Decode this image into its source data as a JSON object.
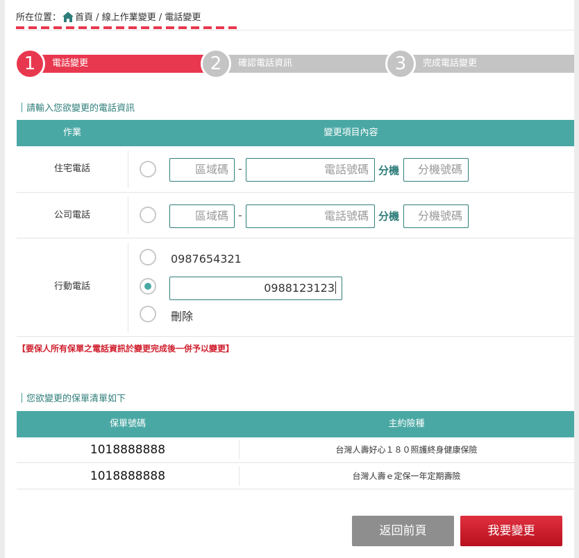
{
  "breadcrumb": {
    "prefix": "所在位置：",
    "home": "首頁",
    "sep1": " / ",
    "level1": "線上作業變更",
    "sep2": " / ",
    "current": "電話變更"
  },
  "steps": [
    {
      "number": "1",
      "label": "電話變更",
      "active": true
    },
    {
      "number": "2",
      "label": "確認電話資訊",
      "active": false
    },
    {
      "number": "3",
      "label": "完成電話變更",
      "active": false
    }
  ],
  "phone_section": {
    "heading": "請輸入您欲變更的電話資訊",
    "col_task": "作業",
    "col_content": "變更項目內容",
    "dash": "-",
    "ext_label": "分機",
    "home_phone": {
      "label": "住宅電話",
      "area_placeholder": "區域碼",
      "number_placeholder": "電話號碼",
      "ext_placeholder": "分機號碼"
    },
    "office_phone": {
      "label": "公司電話",
      "area_placeholder": "區域碼",
      "number_placeholder": "電話號碼",
      "ext_placeholder": "分機號碼"
    },
    "mobile": {
      "label": "行動電話",
      "current_number": "0987654321",
      "new_number": "0988123123",
      "delete_label": "刪除",
      "selected_option": "new_number"
    }
  },
  "notice": "【要保人所有保單之電話資訊於變更完成後一併予以變更】",
  "policy_section": {
    "heading": "您欲變更的保單清單如下",
    "col_number": "保單號碼",
    "col_product": "主約險種",
    "rows": [
      {
        "number": "1018888888",
        "product": "台灣人壽好心１８０照護終身健康保險"
      },
      {
        "number": "1018888888",
        "product": "台灣人壽ｅ定保一年定期壽險"
      }
    ]
  },
  "buttons": {
    "back": "返回前頁",
    "submit": "我要變更"
  },
  "colors": {
    "accent_red": "#e8384f",
    "teal": "#4aa8a4",
    "step_inactive": "#c4c4c4",
    "notice_red": "#d0212f"
  }
}
